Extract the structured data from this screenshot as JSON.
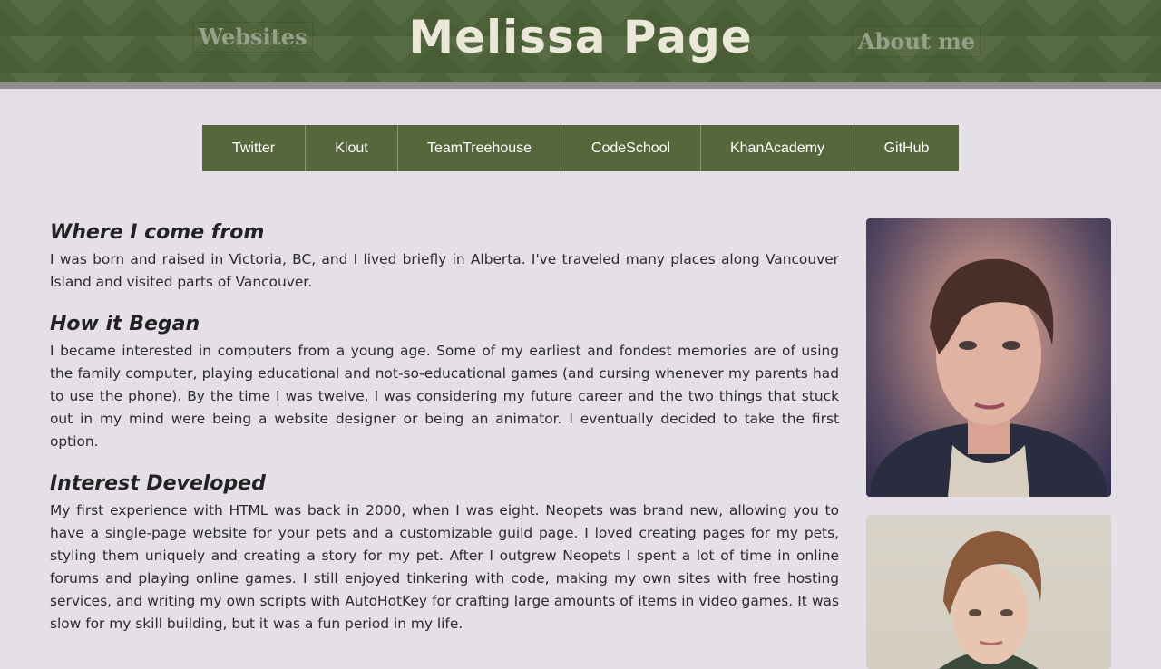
{
  "header": {
    "title": "Melissa Page",
    "left_link": "Websites",
    "right_link": "About me"
  },
  "nav": {
    "items": [
      "Twitter",
      "Klout",
      "TeamTreehouse",
      "CodeSchool",
      "KhanAcademy",
      "GitHub"
    ]
  },
  "sections": [
    {
      "heading": "Where I come from",
      "text": "I was born and raised in Victoria, BC, and I lived briefly in Alberta. I've traveled many places along Vancouver Island and visited parts of Vancouver."
    },
    {
      "heading": "How it Began",
      "text": "I became interested in computers from a young age. Some of my earliest and fondest memories are of using the family computer, playing educational and not-so-educational games (and cursing whenever my parents had to use the phone). By the time I was twelve, I was considering my future career and the two things that stuck out in my mind were being a website designer or being an animator. I eventually decided to take the first option."
    },
    {
      "heading": "Interest Developed",
      "text": "My first experience with HTML was back in 2000, when I was eight. Neopets was brand new, allowing you to have a single-page website for your pets and a customizable guild page. I loved creating pages for my pets, styling them uniquely and creating a story for my pet. After I outgrew Neopets I spent a lot of time in online forums and playing online games. I still enjoyed tinkering with code, making my own sites with free hosting services, and writing my own scripts with AutoHotKey for crafting large amounts of items in video games. It was slow for my skill building, but it was a fun period in my life."
    }
  ],
  "colors": {
    "header_green": "#4d6238",
    "nav_green": "#56683b",
    "page_background": "#e5dfe8",
    "title_color": "#ece8d9"
  }
}
